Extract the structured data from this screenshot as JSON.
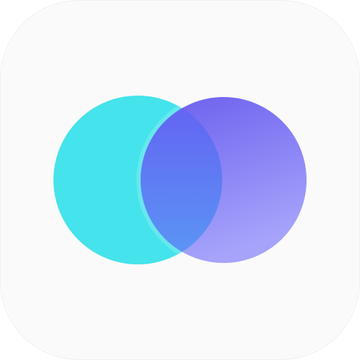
{
  "app_icon": {
    "symbol": "overlapping-circles-icon",
    "colors": {
      "tile_background": "#FAFAFA",
      "left_circle": "#45E3EB",
      "right_circle_top": "#6A5EEE",
      "right_circle_bottom": "#A6A3FB",
      "overlap_top": "#6461F2",
      "overlap_bottom": "#5A98F5"
    }
  }
}
